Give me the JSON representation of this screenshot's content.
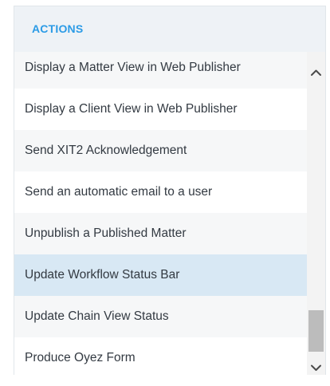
{
  "panel": {
    "title": "ACTIONS"
  },
  "actions": [
    {
      "label": "Display a Matter View in Web Publisher",
      "selected": false
    },
    {
      "label": "Display a Client View in Web Publisher",
      "selected": false
    },
    {
      "label": "Send XIT2 Acknowledgement",
      "selected": false
    },
    {
      "label": "Send an automatic email to a user",
      "selected": false
    },
    {
      "label": "Unpublish a Published Matter",
      "selected": false
    },
    {
      "label": "Update Workflow Status Bar",
      "selected": true
    },
    {
      "label": "Update Chain View Status",
      "selected": false
    },
    {
      "label": "Produce Oyez Form",
      "selected": false
    }
  ],
  "scrollbar": {
    "up_icon": "chevron-up-icon",
    "down_icon": "chevron-down-icon",
    "position_fraction": 0.85
  },
  "colors": {
    "title": "#2b9be6",
    "header_bg": "#eef2f6",
    "selected_bg": "#d8e8f4",
    "text": "#333a42"
  }
}
